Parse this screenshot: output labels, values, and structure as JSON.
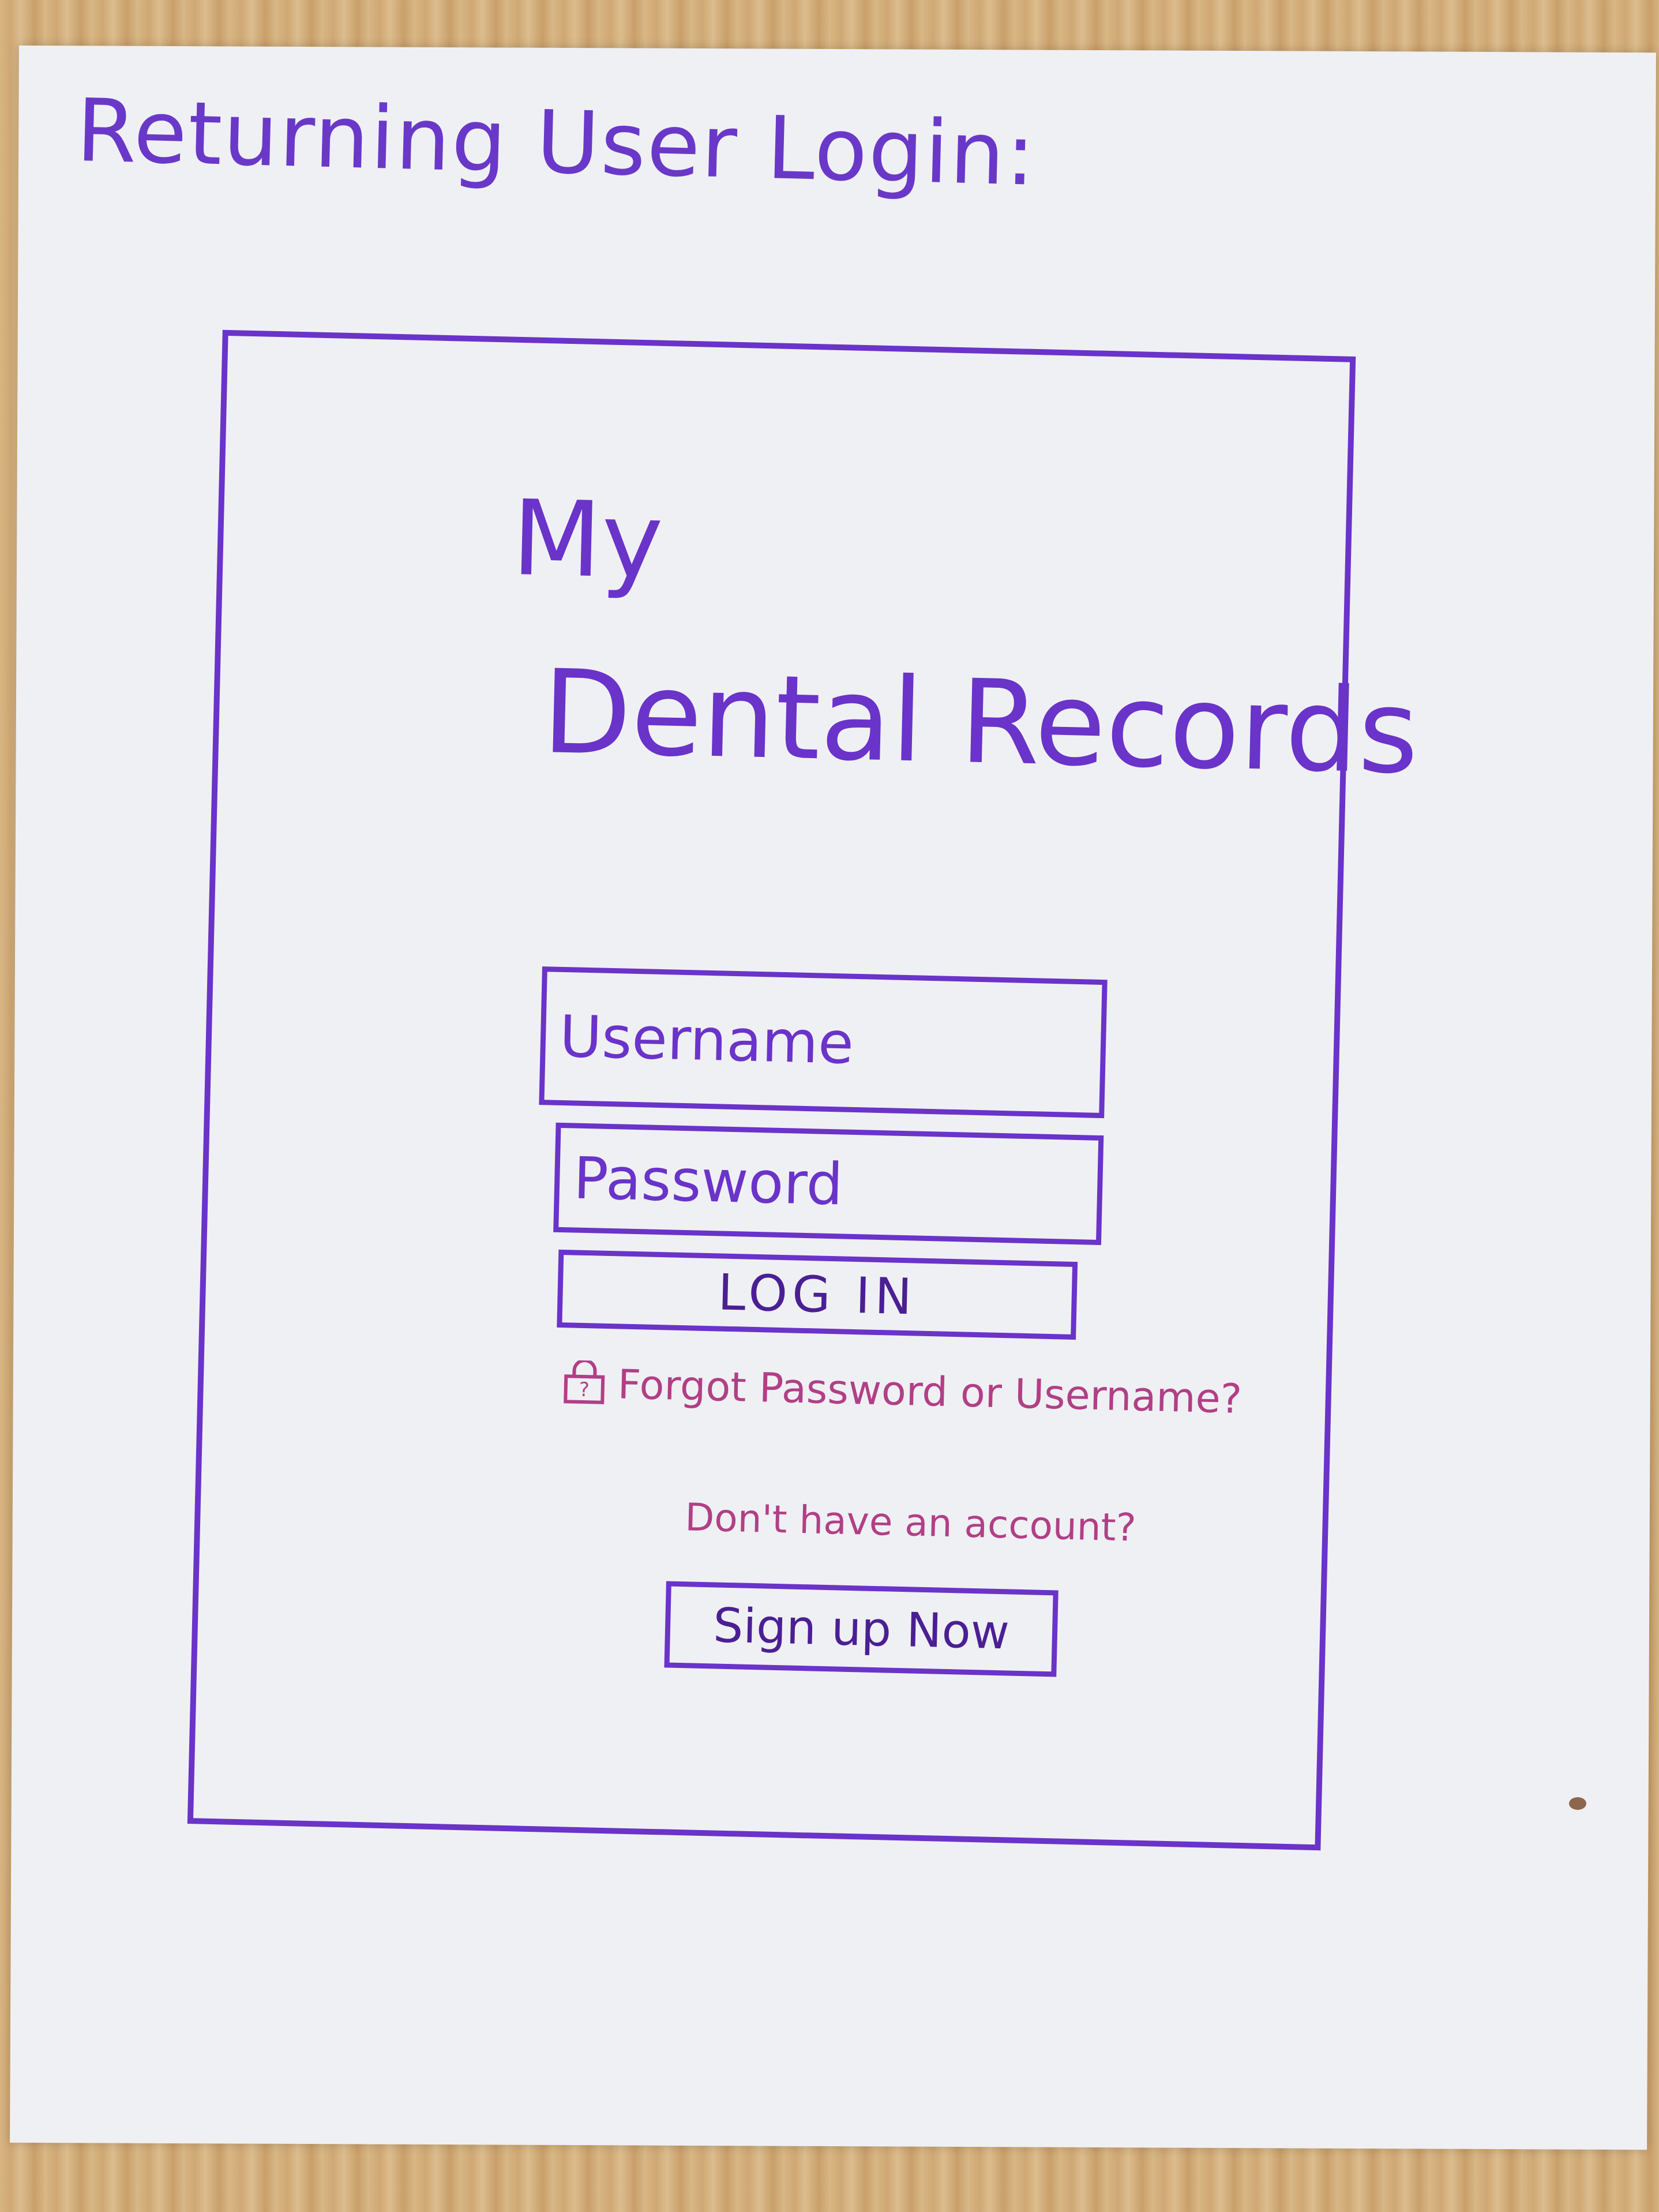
{
  "page": {
    "heading": "Returning User Login:"
  },
  "app": {
    "title_line1": "My",
    "title_line2": "Dental Records"
  },
  "form": {
    "username_placeholder": "Username",
    "password_placeholder": "Password",
    "login_label": "LOG IN",
    "forgot_link": "Forgot Password or Username?",
    "no_account_text": "Don't have an account?",
    "signup_label": "Sign up Now"
  },
  "colors": {
    "primary_ink": "#6a33c9",
    "accent_ink": "#b13f86",
    "paper": "#eff0f3"
  },
  "icons": {
    "forgot": "lock-icon"
  }
}
